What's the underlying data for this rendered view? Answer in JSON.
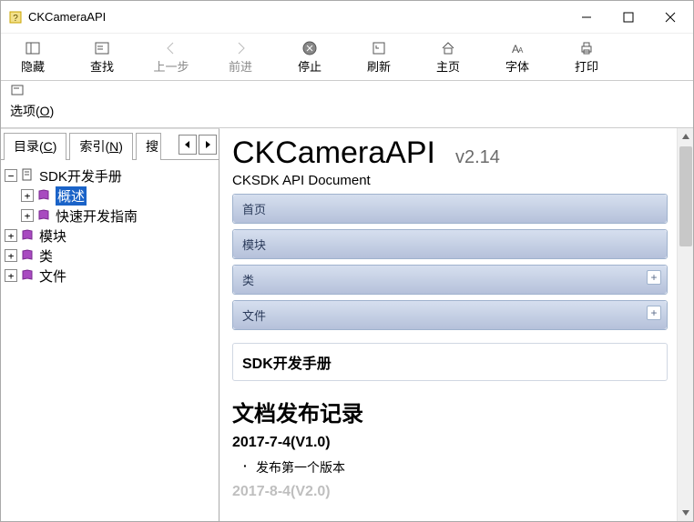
{
  "window": {
    "title": "CKCameraAPI"
  },
  "toolbar": {
    "hide": "隐藏",
    "find": "查找",
    "back": "上一步",
    "forward": "前进",
    "stop": "停止",
    "refresh": "刷新",
    "home": "主页",
    "font": "字体",
    "print": "打印",
    "options_pre": "选项(",
    "options_u": "O",
    "options_post": ")"
  },
  "tabs": {
    "contents_pre": "目录(",
    "contents_u": "C",
    "contents_post": ")",
    "index_pre": "索引(",
    "index_u": "N",
    "index_post": ")",
    "search_label": "搜"
  },
  "tree": {
    "root": "SDK开发手册",
    "overview": "概述",
    "quick": "快速开发指南",
    "modules": "模块",
    "classes": "类",
    "files": "文件"
  },
  "doc": {
    "title": "CKCameraAPI",
    "version": "v2.14",
    "subtitle": "CKSDK API Document",
    "nav_home": "首页",
    "nav_modules": "模块",
    "nav_classes": "类",
    "nav_files": "文件",
    "section": "SDK开发手册",
    "h2": "文档发布记录",
    "h3a": "2017-7-4(V1.0)",
    "li1": "发布第一个版本",
    "h3b": "2017-8-4(V2.0)"
  }
}
